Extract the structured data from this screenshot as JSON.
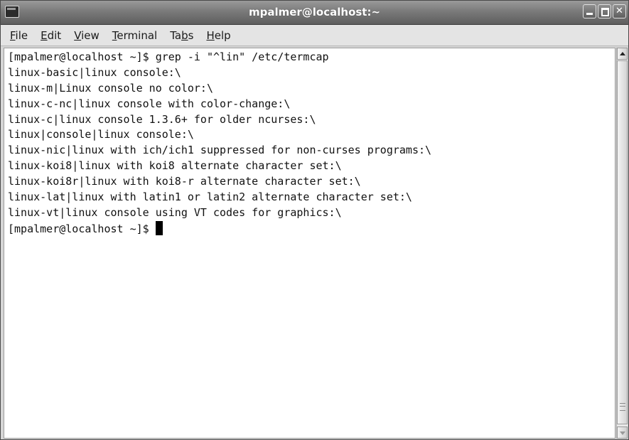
{
  "window": {
    "title": "mpalmer@localhost:~"
  },
  "menubar": {
    "items": [
      {
        "mnemonic": "F",
        "rest": "ile"
      },
      {
        "mnemonic": "E",
        "rest": "dit"
      },
      {
        "mnemonic": "V",
        "rest": "iew"
      },
      {
        "mnemonic": "T",
        "rest": "erminal"
      },
      {
        "pre": "Ta",
        "mnemonic": "b",
        "rest": "s"
      },
      {
        "mnemonic": "H",
        "rest": "elp"
      }
    ]
  },
  "terminal": {
    "lines": [
      "[mpalmer@localhost ~]$ grep -i \"^lin\" /etc/termcap",
      "linux-basic|linux console:\\",
      "linux-m|Linux console no color:\\",
      "linux-c-nc|linux console with color-change:\\",
      "linux-c|linux console 1.3.6+ for older ncurses:\\",
      "linux|console|linux console:\\",
      "linux-nic|linux with ich/ich1 suppressed for non-curses programs:\\",
      "linux-koi8|linux with koi8 alternate character set:\\",
      "linux-koi8r|linux with koi8-r alternate character set:\\",
      "linux-lat|linux with latin1 or latin2 alternate character set:\\",
      "linux-vt|linux console using VT codes for graphics:\\"
    ],
    "prompt": "[mpalmer@localhost ~]$ "
  },
  "colors": {
    "titlebar": "#7a7a7a",
    "terminal_bg": "#ffffff",
    "terminal_fg": "#111111"
  },
  "icons": {
    "window_icon": "terminal-icon",
    "minimize": "minimize-icon",
    "maximize": "maximize-icon",
    "close": "close-icon"
  }
}
